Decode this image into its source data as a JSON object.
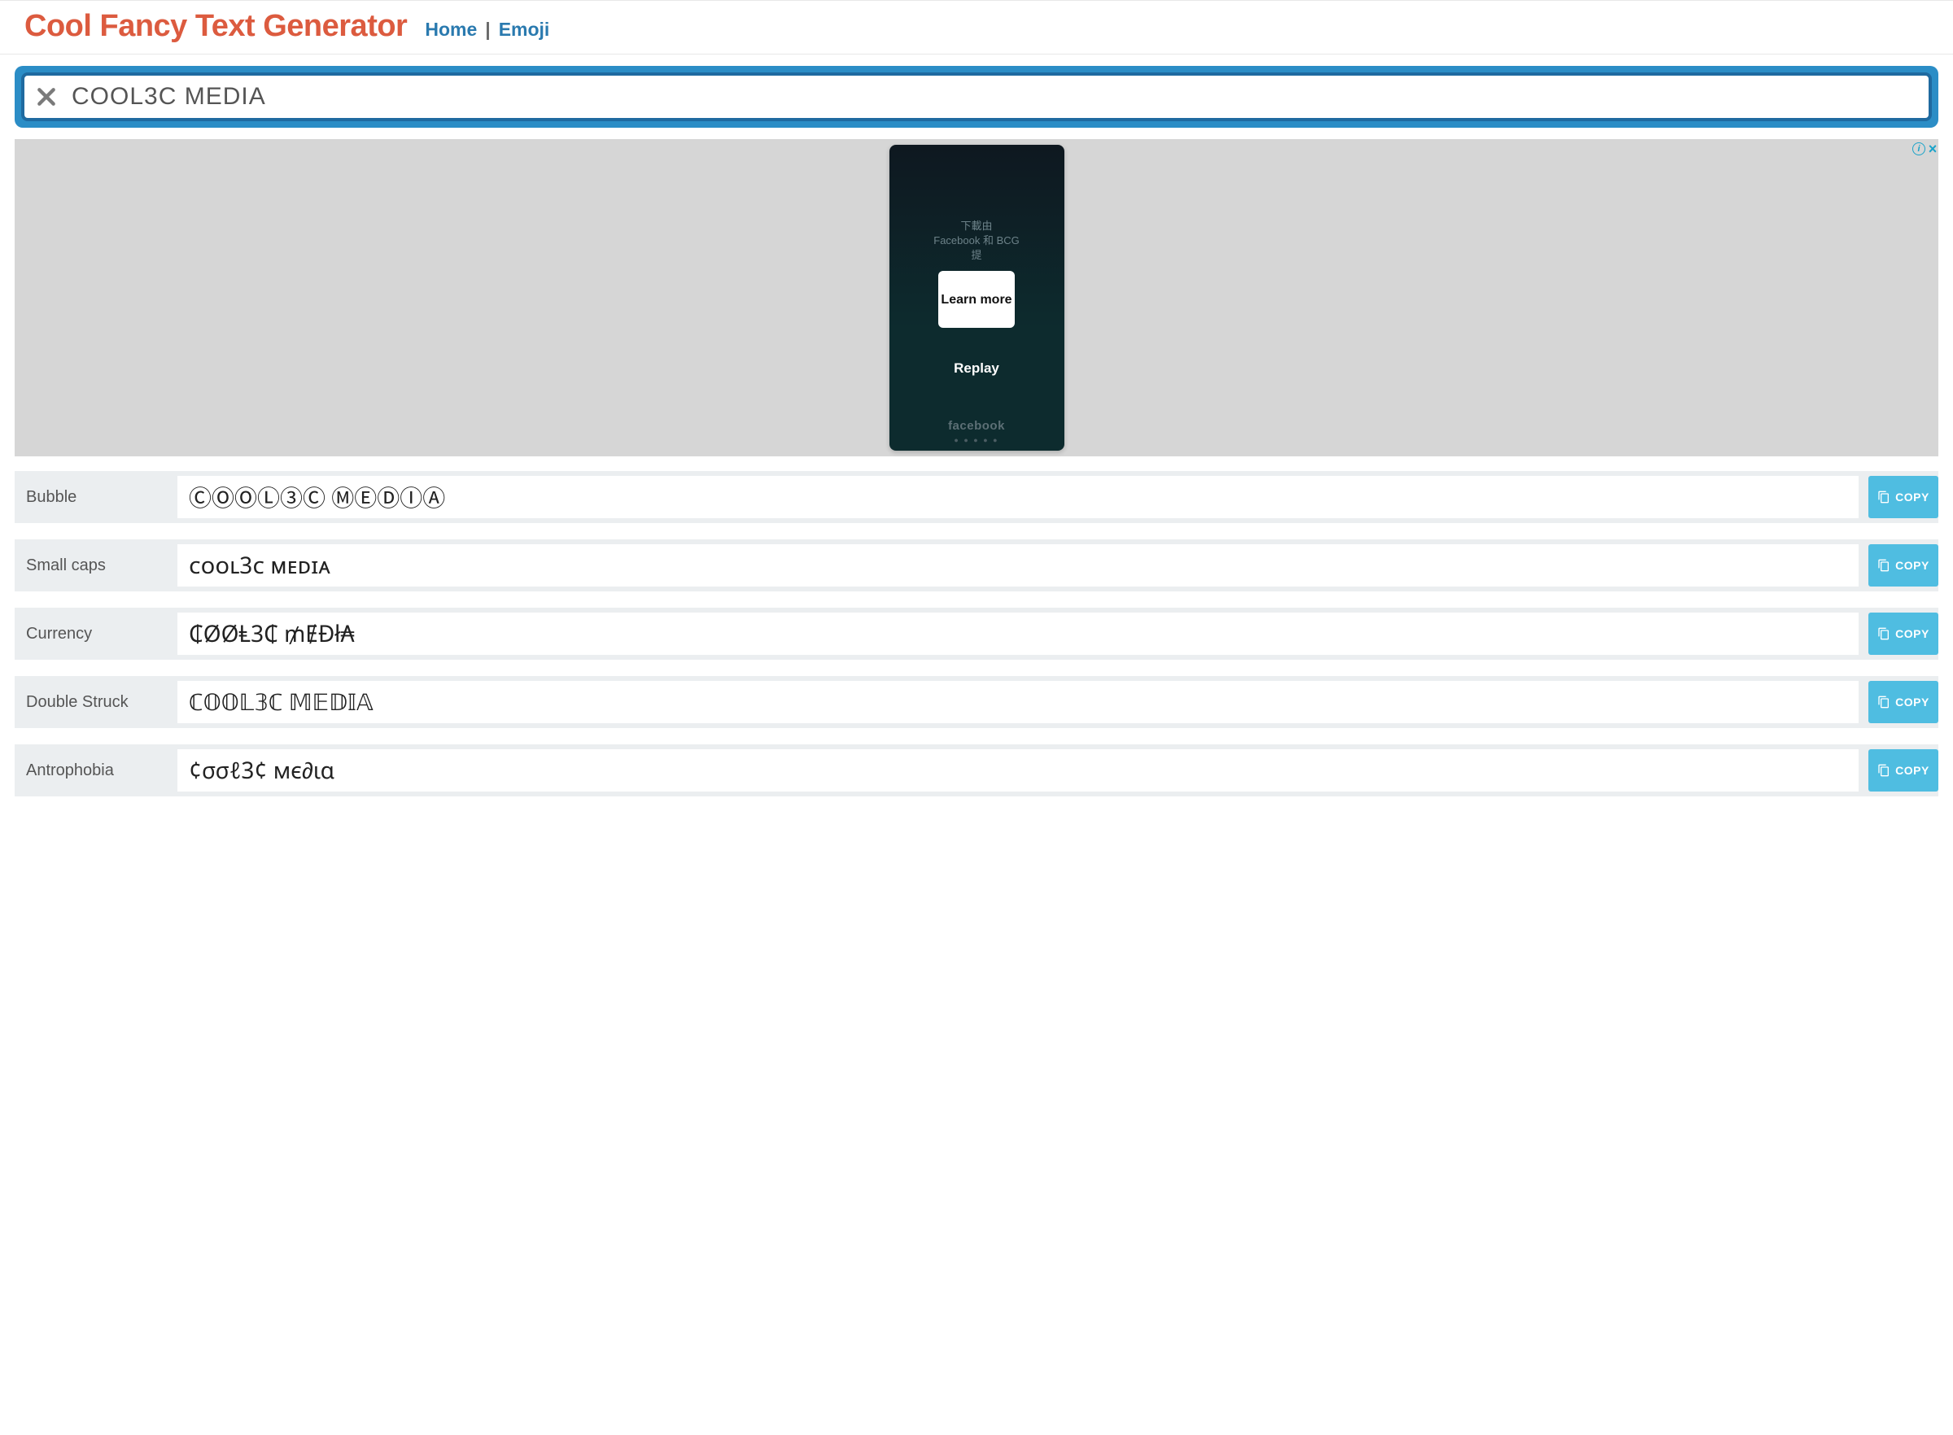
{
  "header": {
    "title": "Cool Fancy Text Generator",
    "nav": {
      "home": "Home",
      "sep": "|",
      "emoji": "Emoji"
    }
  },
  "input": {
    "value": "COOL3C MEDIA"
  },
  "ad": {
    "faint_line1": "下載由",
    "faint_line2": "Facebook 和 BCG",
    "faint_line3": "提",
    "learn_more": "Learn more",
    "replay": "Replay",
    "brand": "facebook",
    "dots": "● ● ● ● ●"
  },
  "copy_label": "COPY",
  "rows": [
    {
      "label": "Bubble",
      "output": "ⒸⓄⓄⓁ③Ⓒ ⓂⒺⒹⒾⒶ"
    },
    {
      "label": "Small caps",
      "output": "ᴄᴏᴏʟ3ᴄ ᴍᴇᴅɪᴀ"
    },
    {
      "label": "Currency",
      "output": "₵ØØⱠ3₵ ₥ɆĐł₳"
    },
    {
      "label": "Double Struck",
      "output": "ℂ𝕆𝕆𝕃𝟛ℂ 𝕄𝔼𝔻𝕀𝔸"
    },
    {
      "label": "Antrophobia",
      "output": "¢σσℓ3¢ мє∂ια"
    }
  ]
}
